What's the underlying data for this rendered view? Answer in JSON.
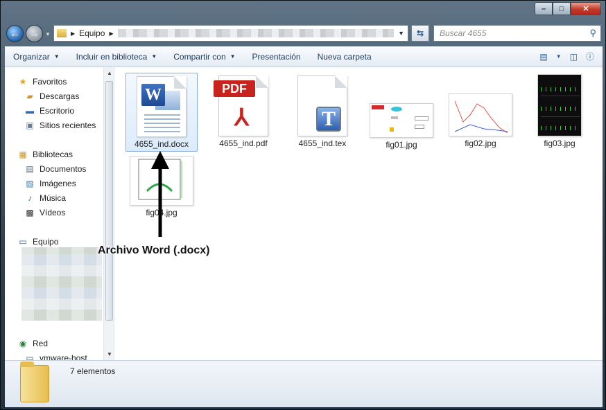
{
  "window": {
    "min": "–",
    "max": "□",
    "close": "✕"
  },
  "address": {
    "root": "Equipo"
  },
  "search": {
    "placeholder": "Buscar 4655"
  },
  "toolbar": {
    "organize": "Organizar",
    "include": "Incluir en biblioteca",
    "share": "Compartir con",
    "presentation": "Presentación",
    "new_folder": "Nueva carpeta"
  },
  "nav": {
    "favorites": "Favoritos",
    "downloads": "Descargas",
    "desktop": "Escritorio",
    "recent": "Sitios recientes",
    "libraries": "Bibliotecas",
    "documents": "Documentos",
    "images": "Imágenes",
    "music": "Música",
    "videos": "Vídeos",
    "computer": "Equipo",
    "network": "Red",
    "vmware": "vmware-host"
  },
  "files": [
    {
      "name": "4655_ind.docx",
      "icon": "word-doc-icon"
    },
    {
      "name": "4655_ind.pdf",
      "icon": "pdf-icon"
    },
    {
      "name": "4655_ind.tex",
      "icon": "tex-icon"
    },
    {
      "name": "fig01.jpg",
      "icon": "image-icon"
    },
    {
      "name": "fig02.jpg",
      "icon": "image-icon"
    },
    {
      "name": "fig03.jpg",
      "icon": "image-icon"
    },
    {
      "name": "fig04.jpg",
      "icon": "image-icon"
    }
  ],
  "status": {
    "count": "7 elementos"
  },
  "annotation": {
    "label": "Archivo Word (.docx)"
  }
}
